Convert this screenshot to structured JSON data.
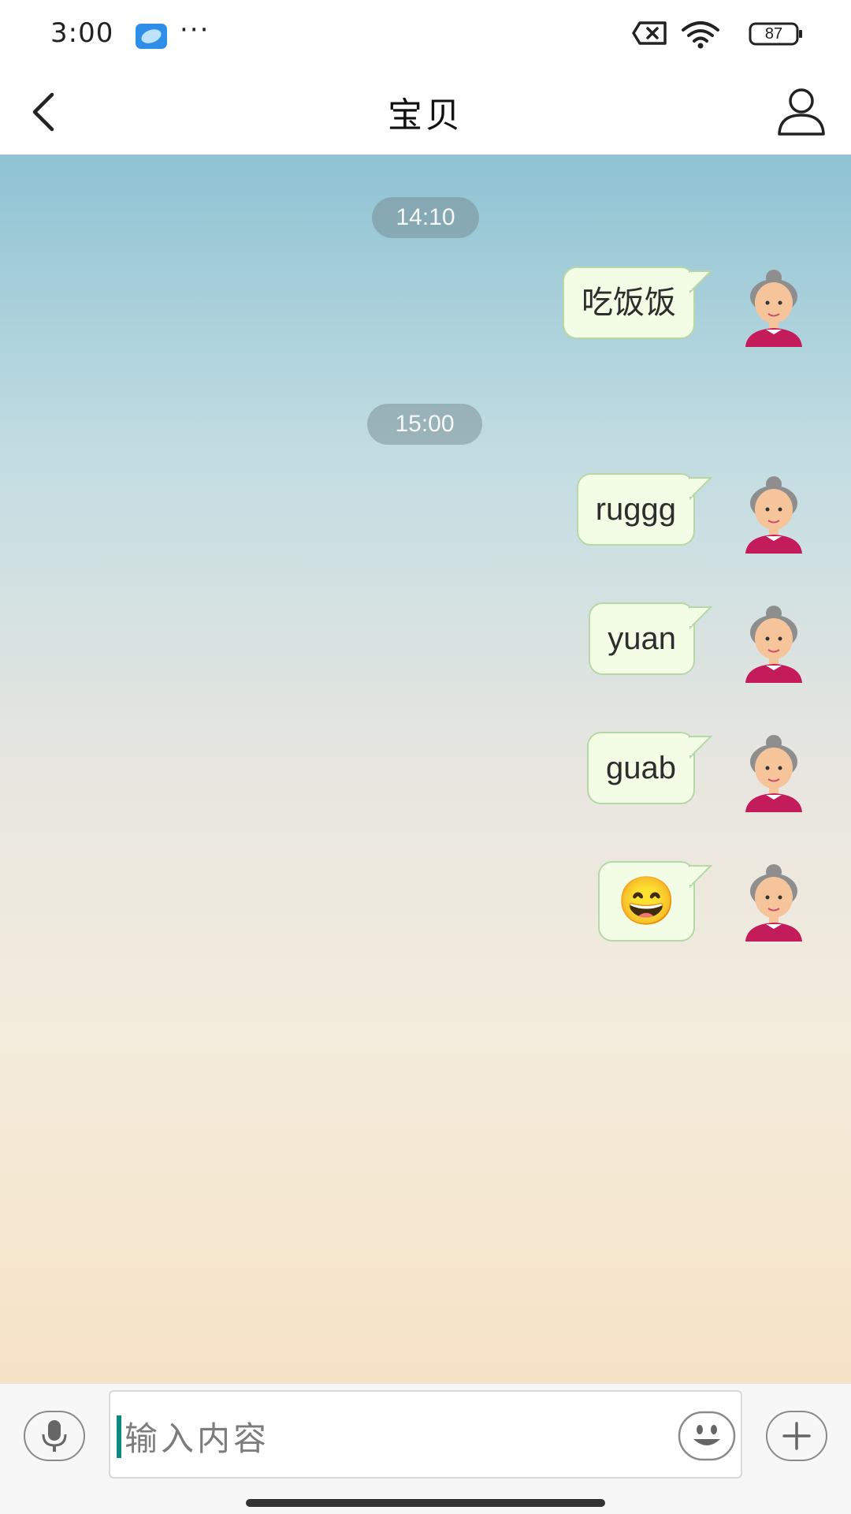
{
  "status_bar": {
    "time": "3:00",
    "dots": "···",
    "battery": "87",
    "icons": [
      "app-notification-icon",
      "no-sim-icon",
      "wifi-icon",
      "battery-icon"
    ]
  },
  "header": {
    "title": "宝贝",
    "back_icon": "chevron-left-icon",
    "profile_icon": "person-icon"
  },
  "chat": {
    "timestamps": [
      "14:10",
      "15:00"
    ],
    "messages": [
      {
        "text": "吃饭饭",
        "sender": "me"
      },
      {
        "text": "ruggg",
        "sender": "me"
      },
      {
        "text": "yuan",
        "sender": "me"
      },
      {
        "text": "guab",
        "sender": "me"
      },
      {
        "text": "😄",
        "sender": "me",
        "type": "emoji"
      }
    ]
  },
  "input": {
    "placeholder": "输入内容",
    "voice_icon": "microphone-icon",
    "emoji_icon": "smiley-icon",
    "more_icon": "plus-icon"
  },
  "colors": {
    "bubble_bg": "#f3fde5",
    "bubble_border": "#b6d7a6",
    "cursor": "#0a8a80"
  }
}
